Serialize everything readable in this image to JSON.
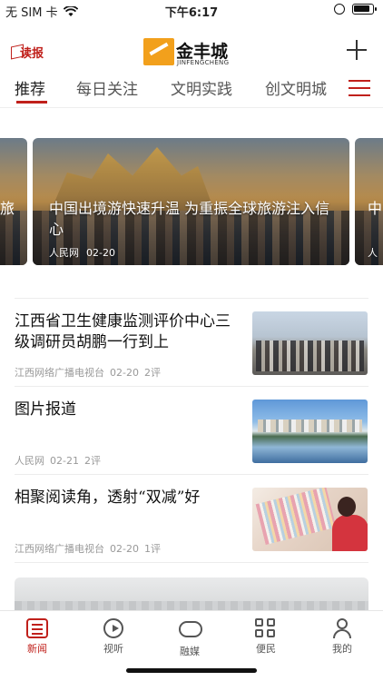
{
  "status_bar": {
    "carrier": "无 SIM 卡",
    "time": "下午6:17",
    "icons": [
      "wifi-icon",
      "orientation-lock-icon",
      "battery-icon"
    ]
  },
  "header": {
    "dubao_label": "读报",
    "logo_name": "金丰城",
    "logo_sub": "JINFENGCHENG",
    "add_icon": "plus-icon"
  },
  "tabs": [
    {
      "label": "推荐",
      "active": true
    },
    {
      "label": "每日关注",
      "active": false
    },
    {
      "label": "文明实践",
      "active": false
    },
    {
      "label": "创文明城",
      "active": false
    }
  ],
  "tabs_menu_icon": "hamburger-menu-icon",
  "carousel": {
    "left_peek_title": "旅",
    "slide": {
      "title": "中国出境游快速升温 为重振全球旅游注入信心",
      "source": "人民网",
      "date": "02-20"
    },
    "right_peek_title": "中",
    "right_peek_source": "人"
  },
  "news": [
    {
      "title": "江西省卫生健康监测评价中心三级调研员胡鹏一行到上",
      "source": "江西网络广播电视台",
      "date": "02-20",
      "comments": "2评"
    },
    {
      "title": "图片报道",
      "source": "人民网",
      "date": "02-21",
      "comments": "2评"
    },
    {
      "title": "相聚阅读角，透射“双减”好",
      "source": "江西网络广播电视台",
      "date": "02-20",
      "comments": "1评"
    }
  ],
  "tabbar": [
    {
      "label": "新闻",
      "icon": "news-icon",
      "active": true
    },
    {
      "label": "视听",
      "icon": "play-icon",
      "active": false
    },
    {
      "label": "融媒",
      "icon": "cloud-icon",
      "active": false
    },
    {
      "label": "便民",
      "icon": "grid-icon",
      "active": false
    },
    {
      "label": "我的",
      "icon": "user-icon",
      "active": false
    }
  ],
  "colors": {
    "accent": "#c0201b",
    "logo_orange": "#f2a01c"
  }
}
